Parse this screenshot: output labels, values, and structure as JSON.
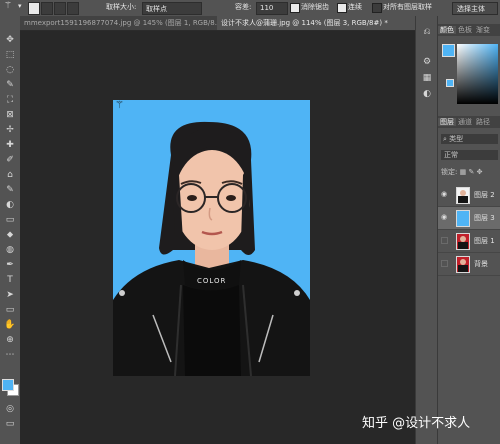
{
  "options_bar": {
    "sample_size_label": "取样大小:",
    "sample_size_value": "取样点",
    "tolerance_label": "容差:",
    "tolerance_value": "110",
    "antialias_label": "消除锯齿",
    "contiguous_label": "连续",
    "all_layers_label": "对所有图层取样",
    "select_subject_label": "选择主体"
  },
  "tabs": [
    {
      "label": "mmexport1591196877074.jpg @ 145% (图层 1, RGB/8...)"
    },
    {
      "label": "设计不求人@蒲珊.jpg @ 114% (图层 3, RGB/8#) *"
    }
  ],
  "tools": [
    "✥",
    "⬚",
    "◌",
    "✎",
    "⛶",
    "⊠",
    "✢",
    "✚",
    "✐",
    "⌂",
    "✎",
    "◐",
    "▭",
    "⬥",
    "◍",
    "✒",
    "T",
    "➤",
    "▭",
    "✋",
    "⊕",
    "⋯"
  ],
  "colors": {
    "foreground": "#4fb4f5",
    "background": "#ffffff",
    "canvas_bg": "#4fb4f5"
  },
  "panel": {
    "color_tabs": [
      "颜色",
      "色板",
      "渐变"
    ],
    "layer_tabs": [
      "图层",
      "通道",
      "路径"
    ],
    "filter_label": "类型",
    "blend_mode": "正常",
    "lock_label": "锁定:",
    "layers": [
      {
        "name": "图层 2",
        "visible": true,
        "selected": false,
        "thumb": "portrait"
      },
      {
        "name": "图层 3",
        "visible": true,
        "selected": true,
        "thumb": "blue"
      },
      {
        "name": "图层 1",
        "visible": false,
        "selected": false,
        "thumb": "red-portrait"
      },
      {
        "name": "背景",
        "visible": false,
        "selected": false,
        "thumb": "red-portrait"
      }
    ]
  },
  "photo": {
    "shirt_text": "COLOR"
  },
  "watermark": "知乎 @设计不求人"
}
